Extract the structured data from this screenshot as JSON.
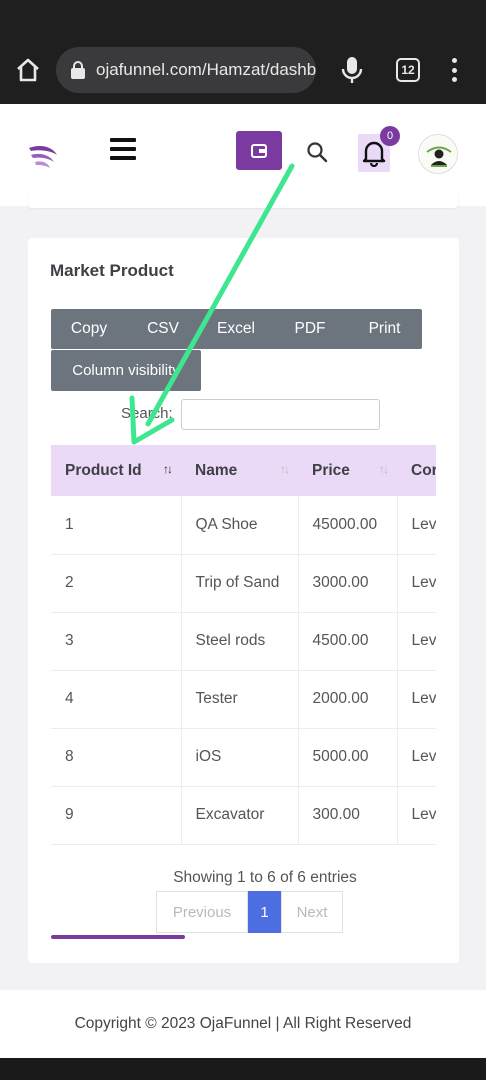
{
  "browser": {
    "url": "ojafunnel.com/Hamzat/dashb",
    "tab_count": "12"
  },
  "header": {
    "notification_count": "0"
  },
  "card": {
    "title": "Market Product",
    "export_buttons": [
      "Copy",
      "CSV",
      "Excel",
      "PDF",
      "Print"
    ],
    "column_visibility_label": "Column visibility",
    "search_label": "Search:",
    "search_value": ""
  },
  "table": {
    "columns": [
      "Product Id",
      "Name",
      "Price",
      "Cor"
    ],
    "rows": [
      [
        "1",
        "QA Shoe",
        "45000.00",
        "Lev"
      ],
      [
        "2",
        "Trip of Sand",
        "3000.00",
        "Lev"
      ],
      [
        "3",
        "Steel rods",
        "4500.00",
        "Lev"
      ],
      [
        "4",
        "Tester",
        "2000.00",
        "Lev"
      ],
      [
        "8",
        "iOS",
        "5000.00",
        "Lev"
      ],
      [
        "9",
        "Excavator",
        "300.00",
        "Lev"
      ]
    ]
  },
  "pagination": {
    "info": "Showing 1 to 6 of 6 entries",
    "previous": "Previous",
    "current_page": "1",
    "next": "Next"
  },
  "footer": {
    "copyright": "Copyright © 2023 OjaFunnel | All Right Reserved"
  },
  "colors": {
    "brand_purple": "#7b3aa0",
    "header_lavender": "#ead9f7",
    "button_gray": "#6c757d",
    "page_active_blue": "#4c6ee0",
    "arrow_green": "#3ee68f"
  }
}
